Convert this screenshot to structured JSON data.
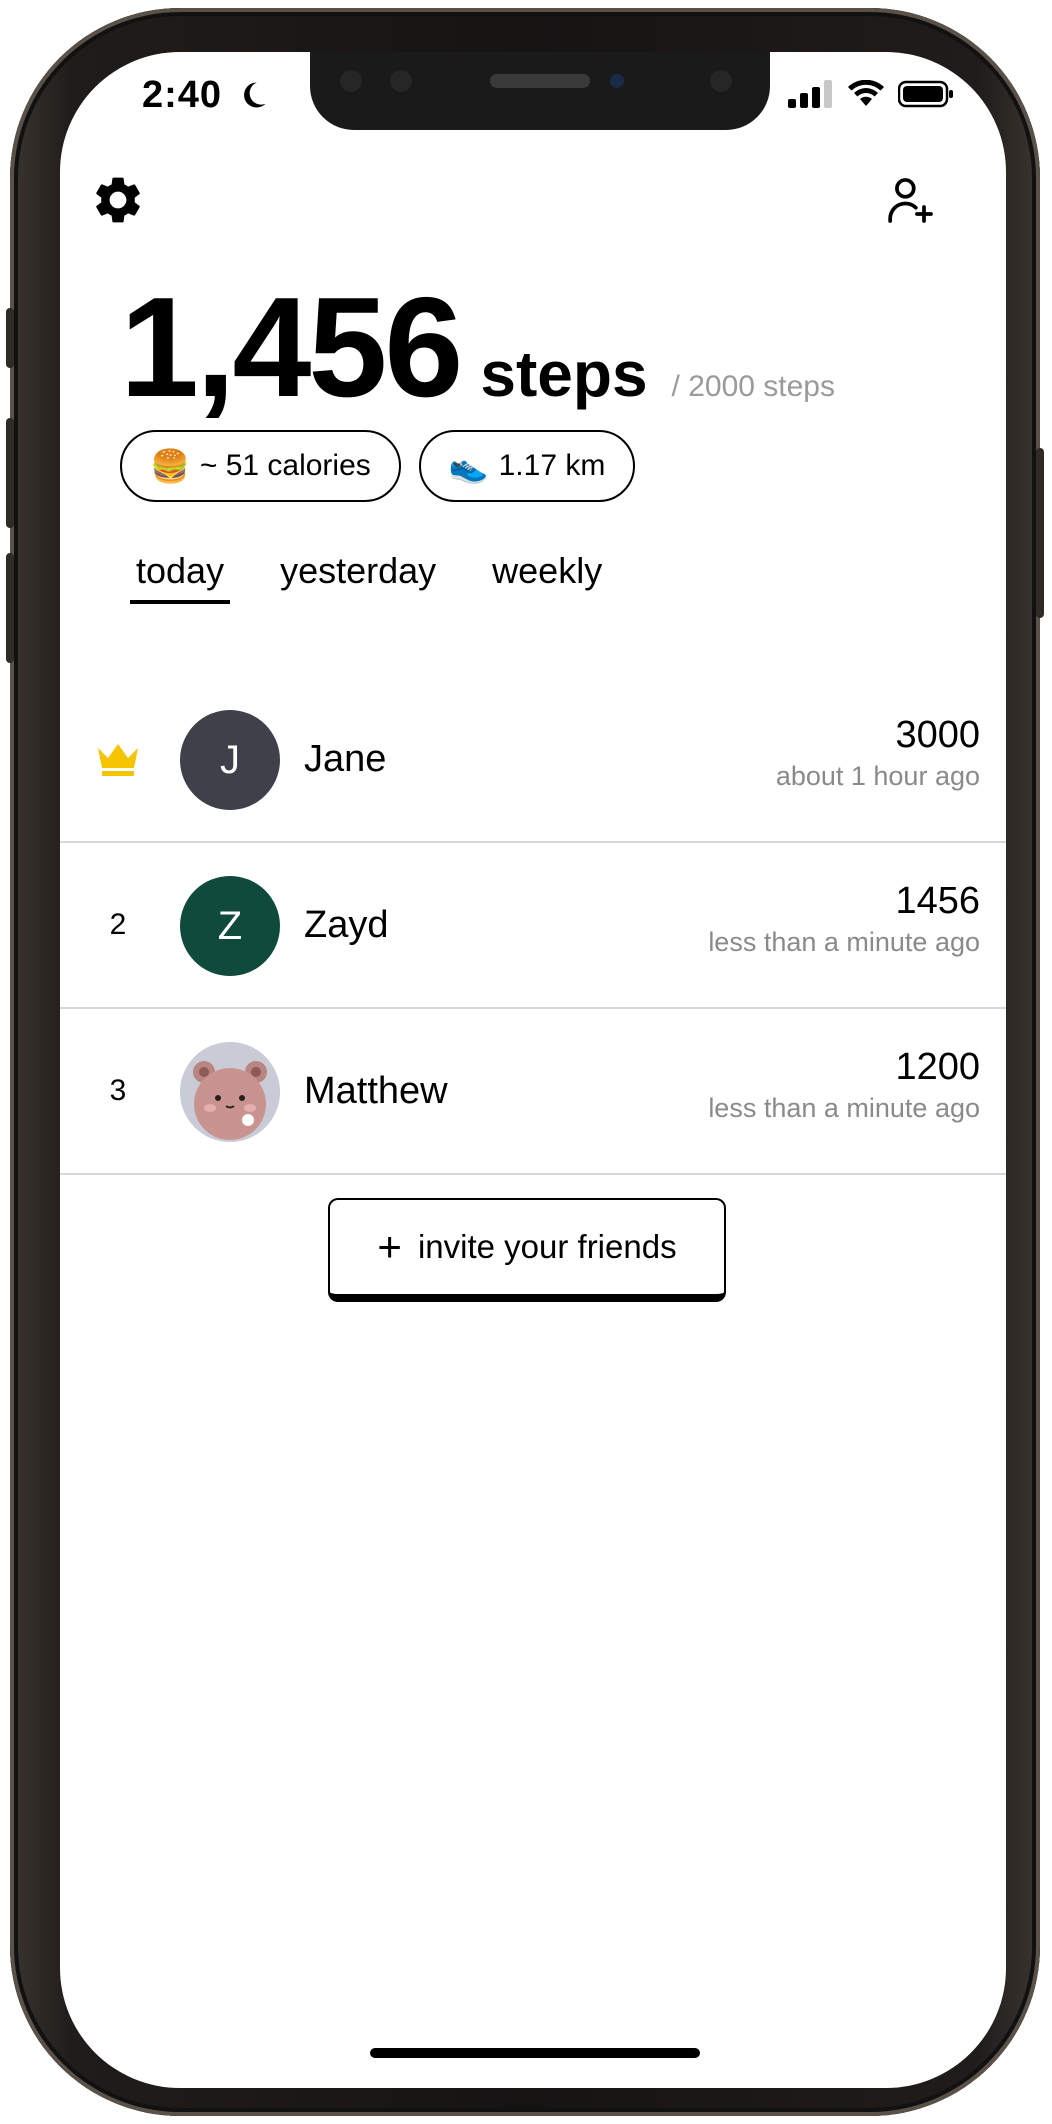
{
  "status_bar": {
    "time": "2:40"
  },
  "summary": {
    "steps": "1,456",
    "steps_unit": "steps",
    "goal": "/ 2000 steps",
    "calories_emoji": "🍔",
    "calories": "~ 51 calories",
    "distance_emoji": "👟",
    "distance": "1.17 km"
  },
  "tabs": [
    {
      "label": "today",
      "active": true
    },
    {
      "label": "yesterday",
      "active": false
    },
    {
      "label": "weekly",
      "active": false
    }
  ],
  "leaderboard": [
    {
      "rank": "",
      "rank_icon": "crown-icon",
      "initial": "J",
      "avatar_color": "#3f4049",
      "name": "Jane",
      "steps": "3000",
      "updated": "about 1 hour ago"
    },
    {
      "rank": "2",
      "initial": "Z",
      "avatar_color": "#0f4a3c",
      "name": "Zayd",
      "steps": "1456",
      "updated": "less than a minute ago"
    },
    {
      "rank": "3",
      "avatar_icon": "bear-avatar-icon",
      "name": "Matthew",
      "steps": "1200",
      "updated": "less than a minute ago"
    }
  ],
  "invite_button": {
    "plus": "+",
    "label": "invite your friends"
  },
  "colors": {
    "crown": "#f5c400",
    "divider": "#d7d7d7",
    "muted_text": "#8a8a8a"
  }
}
